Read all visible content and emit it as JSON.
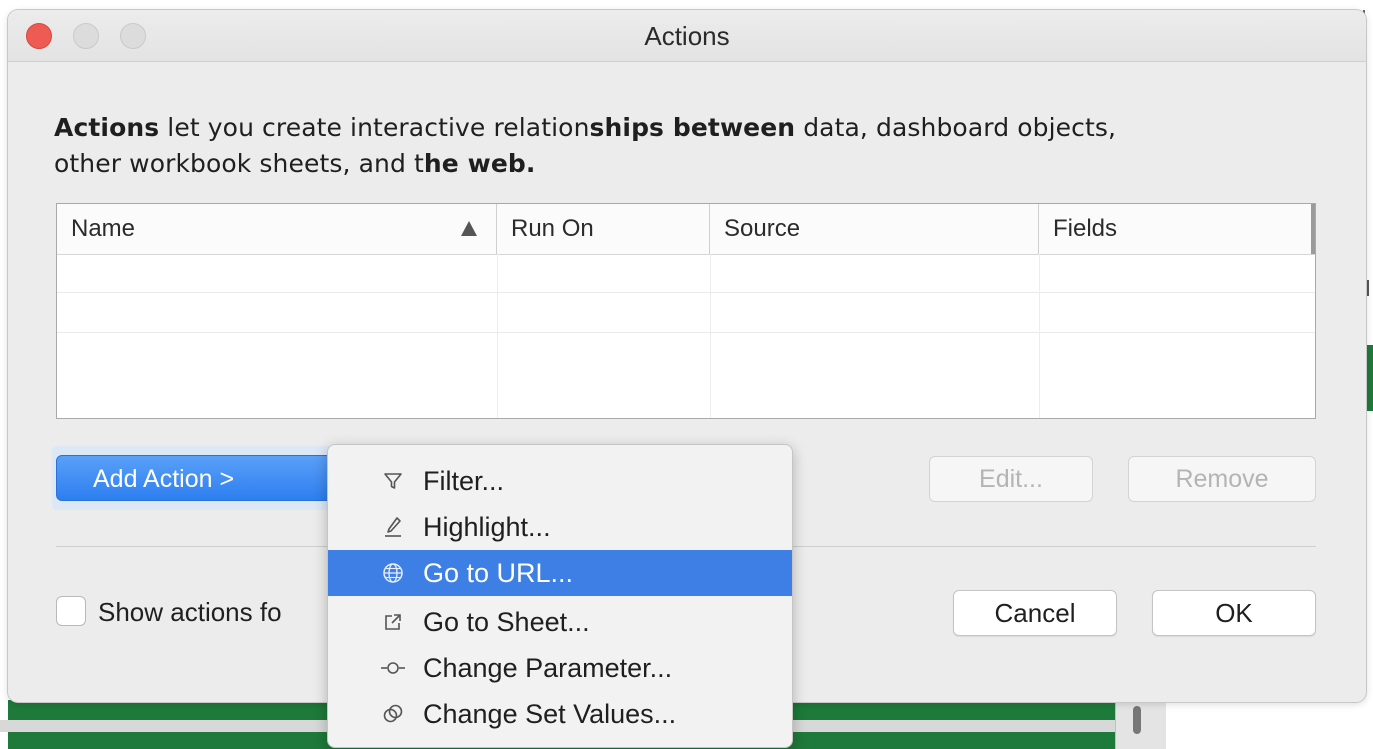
{
  "window": {
    "title": "Actions"
  },
  "description": {
    "part1": "Actions",
    "part2": " let you create interactive relation",
    "part3": "ships between",
    "part4": " data, dashboard objects,",
    "part5": "other workbook shee",
    "part6": "ts, and t",
    "part7": "he web."
  },
  "table": {
    "columns": [
      "Name",
      "Run On",
      "Source",
      "Fields"
    ],
    "sort_icon": "sort-ascending-triangle",
    "rows": []
  },
  "buttons": {
    "add_action": "Add Action >",
    "edit": "Edit...",
    "remove": "Remove",
    "cancel": "Cancel",
    "ok": "OK"
  },
  "checkbox": {
    "label": "Show actions fo",
    "checked": false
  },
  "menu": {
    "items": [
      {
        "label": "Filter...",
        "icon": "filter-icon"
      },
      {
        "label": "Highlight...",
        "icon": "highlight-pen-icon"
      },
      {
        "label": "Go to URL...",
        "icon": "globe-icon",
        "selected": true
      },
      {
        "label": "Go to Sheet...",
        "icon": "external-link-icon"
      },
      {
        "label": "Change Parameter...",
        "icon": "parameter-icon"
      },
      {
        "label": "Change Set Values...",
        "icon": "set-values-icon"
      }
    ]
  },
  "colors": {
    "accent": "#3d7fe5",
    "close_button": "#ee5b52"
  }
}
